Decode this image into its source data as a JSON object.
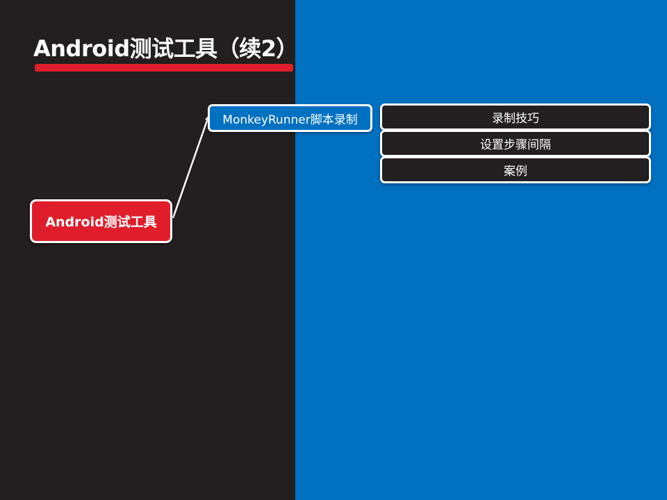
{
  "slide": {
    "title": "Android测试工具（续2）",
    "colors": {
      "left_background": "#231f20",
      "right_background": "#0070c0",
      "accent_red": "#e01e2b",
      "mid_node_fill": "#0070c0",
      "leaf_node_fill": "#231f20",
      "border": "#ffffff"
    }
  },
  "mindmap": {
    "root": {
      "label": "Android测试工具"
    },
    "branch": {
      "label": "MonkeyRunner脚本录制"
    },
    "leaves": [
      {
        "label": "录制技巧"
      },
      {
        "label": "设置步骤间隔"
      },
      {
        "label": "案例"
      }
    ]
  }
}
